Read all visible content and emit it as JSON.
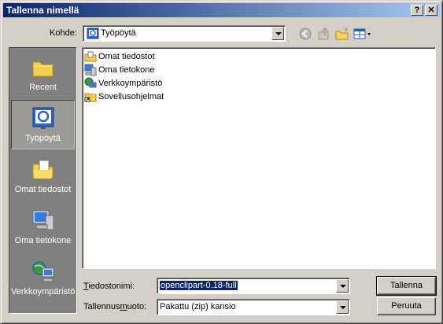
{
  "window": {
    "title": "Tallenna nimellä",
    "help_label": "?",
    "close_label": "✕"
  },
  "lookin": {
    "label": "Kohde:",
    "value": "Työpöytä",
    "icon": "desktop-icon"
  },
  "toolbar": {
    "icons": [
      "back-icon",
      "up-folder-icon",
      "new-folder-icon",
      "view-menu-icon"
    ]
  },
  "places": [
    {
      "label": "Recent",
      "icon": "recent-folder-icon"
    },
    {
      "label": "Työpöytä",
      "icon": "desktop-icon",
      "selected": true
    },
    {
      "label": "Omat tiedostot",
      "icon": "my-documents-icon"
    },
    {
      "label": "Oma tietokone",
      "icon": "my-computer-icon"
    },
    {
      "label": "Verkkoympäristö",
      "icon": "network-icon"
    }
  ],
  "files": [
    {
      "name": "Omat tiedostot",
      "icon": "my-documents-icon"
    },
    {
      "name": "Oma tietokone",
      "icon": "my-computer-icon"
    },
    {
      "name": "Verkkoympäristö",
      "icon": "network-icon"
    },
    {
      "name": "Sovellusohjelmat",
      "icon": "folder-shortcut-icon"
    }
  ],
  "filename": {
    "label_first": "T",
    "label_rest": "iedostonimi:",
    "value": "openclipart-0.18-full"
  },
  "filetype": {
    "label_first": "Tallennus",
    "label_u": "m",
    "label_rest": "uoto:",
    "value": "Pakattu (zip) kansio"
  },
  "buttons": {
    "save": "Tallenna",
    "cancel": "Peruuta"
  },
  "colors": {
    "titlebar_start": "#0a246a",
    "titlebar_end": "#a6caf0",
    "face": "#d4d0c8",
    "places_bg": "#808080",
    "selection": "#0a246a"
  }
}
